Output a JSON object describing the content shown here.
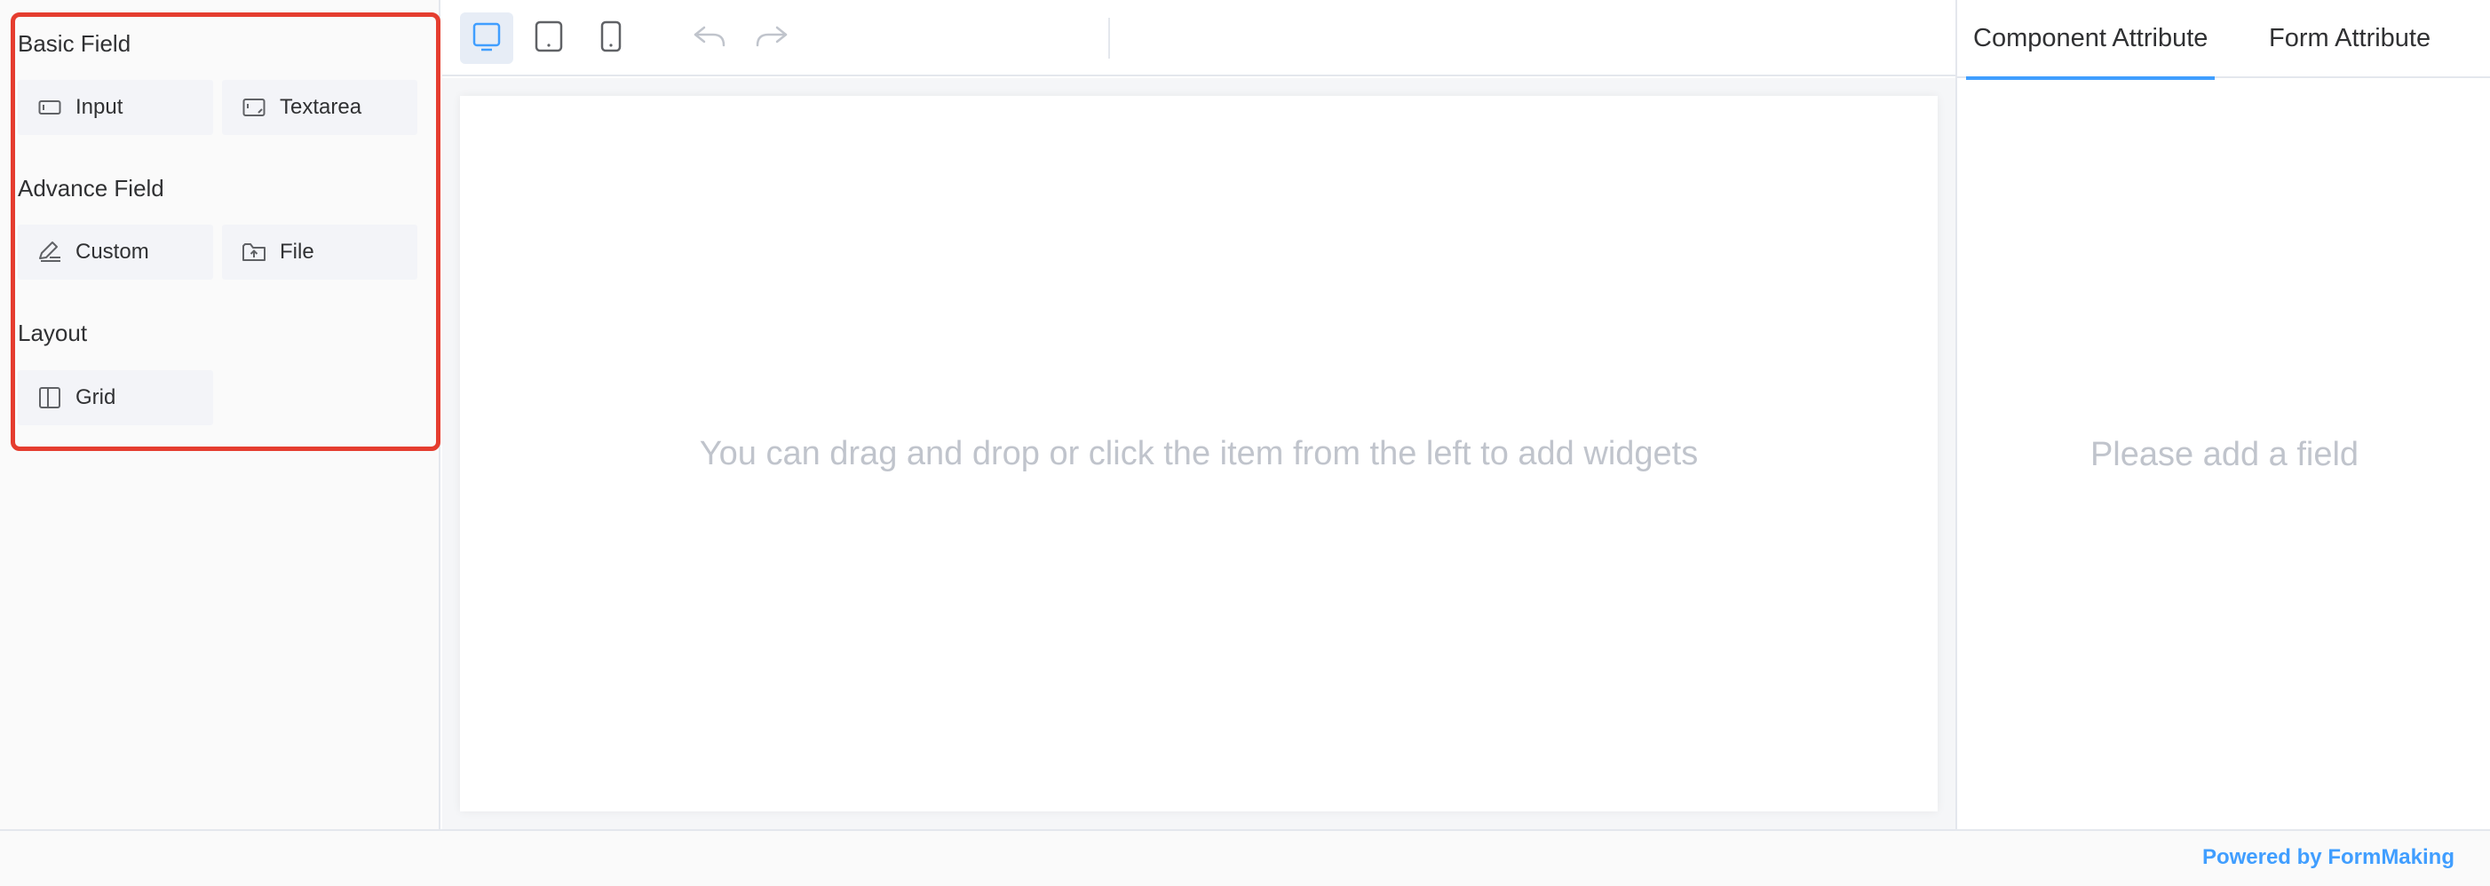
{
  "left_panel": {
    "groups": [
      {
        "title": "Basic Field",
        "items": [
          {
            "label": "Input",
            "icon": "input-icon"
          },
          {
            "label": "Textarea",
            "icon": "textarea-icon"
          }
        ]
      },
      {
        "title": "Advance Field",
        "items": [
          {
            "label": "Custom",
            "icon": "custom-edit-icon"
          },
          {
            "label": "File",
            "icon": "file-upload-icon"
          }
        ]
      },
      {
        "title": "Layout",
        "items": [
          {
            "label": "Grid",
            "icon": "grid-icon"
          }
        ]
      }
    ],
    "highlight_color": "#e53d2f"
  },
  "toolbar": {
    "buttons": [
      {
        "icon": "desktop-icon",
        "active": true
      },
      {
        "icon": "tablet-icon",
        "active": false
      },
      {
        "icon": "mobile-icon",
        "active": false
      },
      {
        "icon": "undo-icon",
        "active": false
      },
      {
        "icon": "redo-icon",
        "active": false
      }
    ]
  },
  "canvas": {
    "hint": "You can drag and drop or click the item from the left to add widgets"
  },
  "right_panel": {
    "tabs": [
      {
        "label": "Component Attribute",
        "active": true
      },
      {
        "label": "Form Attribute",
        "active": false
      }
    ],
    "empty_text": "Please add a field"
  },
  "footer": {
    "text": "Powered by FormMaking"
  },
  "colors": {
    "accent": "#409eff",
    "placeholder_text": "#c0c4cc"
  }
}
